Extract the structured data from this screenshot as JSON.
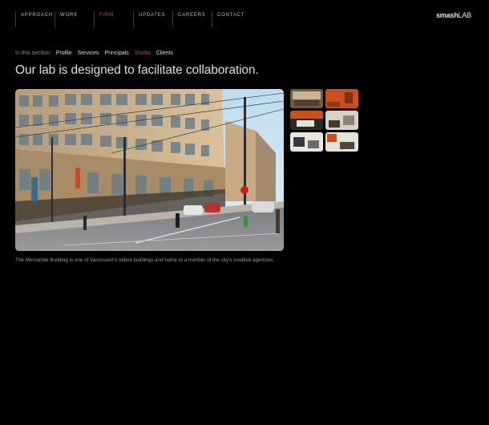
{
  "nav": {
    "items": [
      {
        "label": "APPROACH",
        "active": false
      },
      {
        "label": "WORK",
        "active": false
      },
      {
        "label": "FIRM",
        "active": true
      },
      {
        "label": "UPDATES",
        "active": false
      },
      {
        "label": "CAREERS",
        "active": false
      },
      {
        "label": "CONTACT",
        "active": false
      }
    ]
  },
  "logo": {
    "bold": "smash",
    "light": "LAB"
  },
  "subnav": {
    "lead": "In this section:",
    "items": [
      {
        "label": "Profile",
        "active": false
      },
      {
        "label": "Services",
        "active": false
      },
      {
        "label": "Principals",
        "active": false
      },
      {
        "label": "Studio",
        "active": true
      },
      {
        "label": "Clients",
        "active": false
      }
    ]
  },
  "headline": "Our lab is designed to facilitate collaboration.",
  "caption": "The Mercantile Building is one of Vancouver's oldest buildings and home to a number of the city's creative agencies.",
  "colors": {
    "accent": "#c8502c",
    "background": "#000000"
  }
}
